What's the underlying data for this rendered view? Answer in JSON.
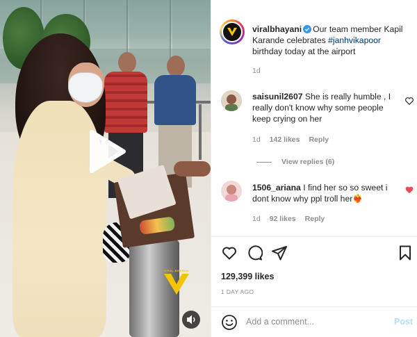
{
  "video": {
    "watermark_text": "VIRAL BHAYANI",
    "watermark_letter": "V",
    "play_icon": "play-icon",
    "audio_icon": "speaker-icon"
  },
  "post": {
    "author": "viralbhayani",
    "verified": true,
    "caption_before": "Our team member Kapil Karande celebrates ",
    "hashtag": "#janhvikapoor",
    "caption_after": " birthday today at the airport",
    "time": "1d"
  },
  "comments": [
    {
      "username": "saisunil2607",
      "text": "She is really humble , I really don't know why some people keep crying on her",
      "time": "1d",
      "likes": "142 likes",
      "reply": "Reply",
      "liked": false,
      "view_replies": "View replies (6)"
    },
    {
      "username": "1506_ariana",
      "text": "I find her so so sweet i dont know why ppl troll her",
      "emoji": "❤️‍🔥",
      "time": "1d",
      "likes": "92 likes",
      "reply": "Reply",
      "liked": true
    }
  ],
  "actions": {
    "like_icon": "heart-icon",
    "comment_icon": "comment-icon",
    "share_icon": "send-icon",
    "save_icon": "bookmark-icon"
  },
  "likes_count": "129,399 likes",
  "date": "1 DAY AGO",
  "add_comment": {
    "placeholder": "Add a comment...",
    "post_label": "Post",
    "emoji_icon": "smiley-icon"
  },
  "colors": {
    "accent_blue": "#0095f6",
    "post_disabled": "#b2dffc",
    "link_blue": "#00376b",
    "like_red": "#ed4956",
    "verified_blue": "#3897f0",
    "watermark_yellow": "#f5c400"
  }
}
